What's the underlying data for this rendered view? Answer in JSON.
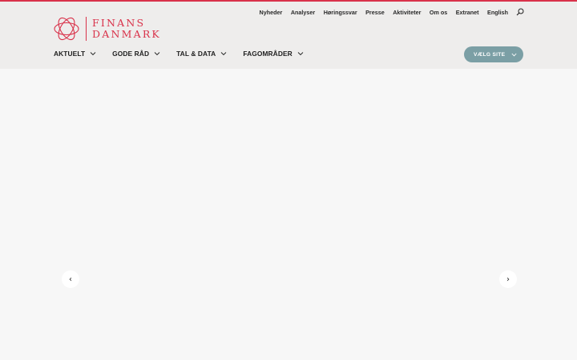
{
  "brand": {
    "line1": "FINANS",
    "line2": "DANMARK",
    "color": "#d9324a"
  },
  "utility_nav": [
    {
      "label": "Nyheder"
    },
    {
      "label": "Analyser"
    },
    {
      "label": "Høringssvar"
    },
    {
      "label": "Presse"
    },
    {
      "label": "Aktiviteter"
    },
    {
      "label": "Om os"
    },
    {
      "label": "Extranet"
    },
    {
      "label": "English"
    }
  ],
  "main_nav": [
    {
      "label": "AKTUELT"
    },
    {
      "label": "GODE RÅD"
    },
    {
      "label": "TAL & DATA"
    },
    {
      "label": "FAGOMRÅDER"
    }
  ],
  "site_selector": {
    "label": "VÆLG SITE",
    "color": "#7b9fa5"
  },
  "carousel": {
    "prev_icon": "‹",
    "next_icon": "›"
  },
  "icons": {
    "search": "search-icon",
    "chevron": "chevron-down-icon",
    "logo": "logo-mark-icon"
  },
  "colors": {
    "accent": "#d9324a",
    "header_bg": "#eeedec",
    "page_bg": "#f7f7f7"
  }
}
